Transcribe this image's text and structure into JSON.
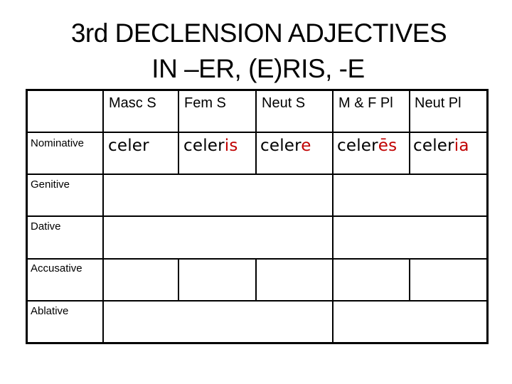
{
  "title": {
    "line1": "3rd DECLENSION ADJECTIVES",
    "line2": "IN –ER, (E)RIS, -E"
  },
  "table": {
    "headers": [
      "",
      "Masc S",
      "Fem S",
      "Neut S",
      "M & F Pl",
      "Neut Pl"
    ],
    "cases": [
      "Nominative",
      "Genitive",
      "Dative",
      "Accusative",
      "Ablative"
    ],
    "nominative_forms": [
      {
        "stem": "celer",
        "ending": ""
      },
      {
        "stem": "celer",
        "ending": "is"
      },
      {
        "stem": "celer",
        "ending": "e"
      },
      {
        "stem": "celer",
        "ending": "ēs"
      },
      {
        "stem": "celer",
        "ending": "ia"
      }
    ],
    "ending_color": "#c00000"
  }
}
